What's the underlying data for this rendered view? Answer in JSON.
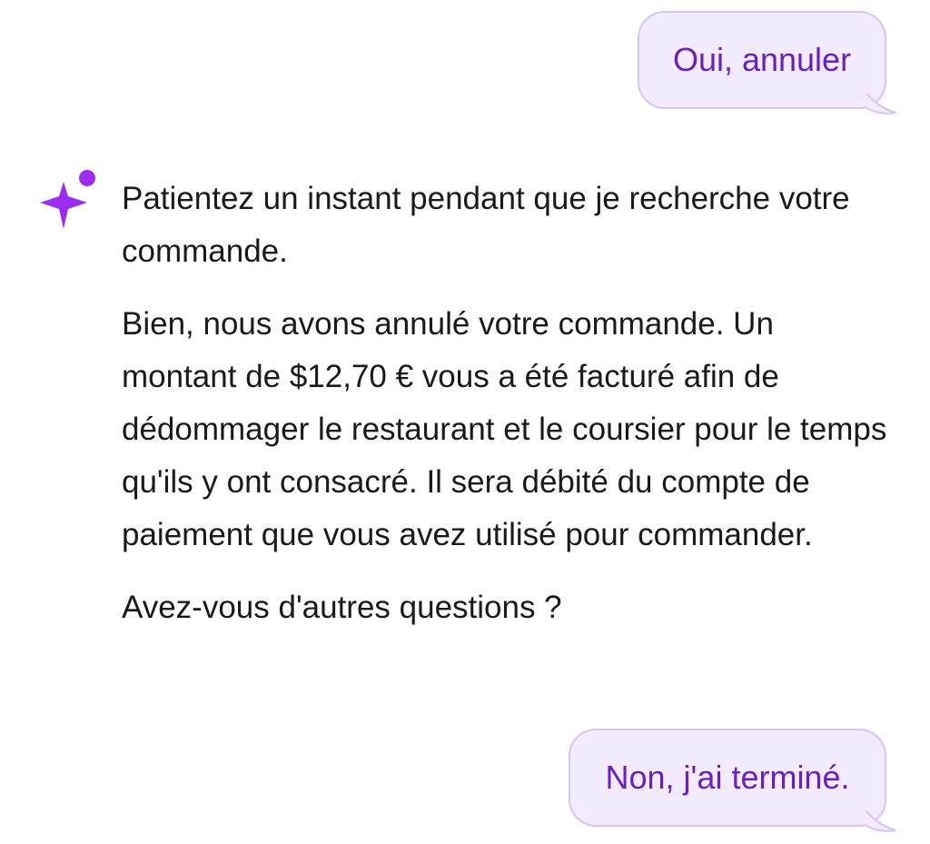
{
  "messages": {
    "user_first": "Oui, annuler",
    "assistant": {
      "paragraph_1": "Patientez un instant pendant que je recherche votre commande.",
      "paragraph_2": "Bien, nous avons annulé votre commande. Un montant de $12,70 € vous a été facturé afin de dédommager le restaurant et le coursier pour le temps qu'ils y ont consacré. Il sera débité du compte de paiement que vous avez utilisé pour commander.",
      "paragraph_3": "Avez-vous d'autres questions ?"
    },
    "user_second": "Non, j'ai terminé."
  },
  "icons": {
    "assistant_avatar": "sparkle-icon"
  },
  "colors": {
    "user_bubble_bg": "#f3ebff",
    "user_bubble_border": "#d6c4f2",
    "user_text": "#6a1fc0",
    "assistant_icon": "#9b2cf0",
    "assistant_text": "#1a1a1a"
  }
}
